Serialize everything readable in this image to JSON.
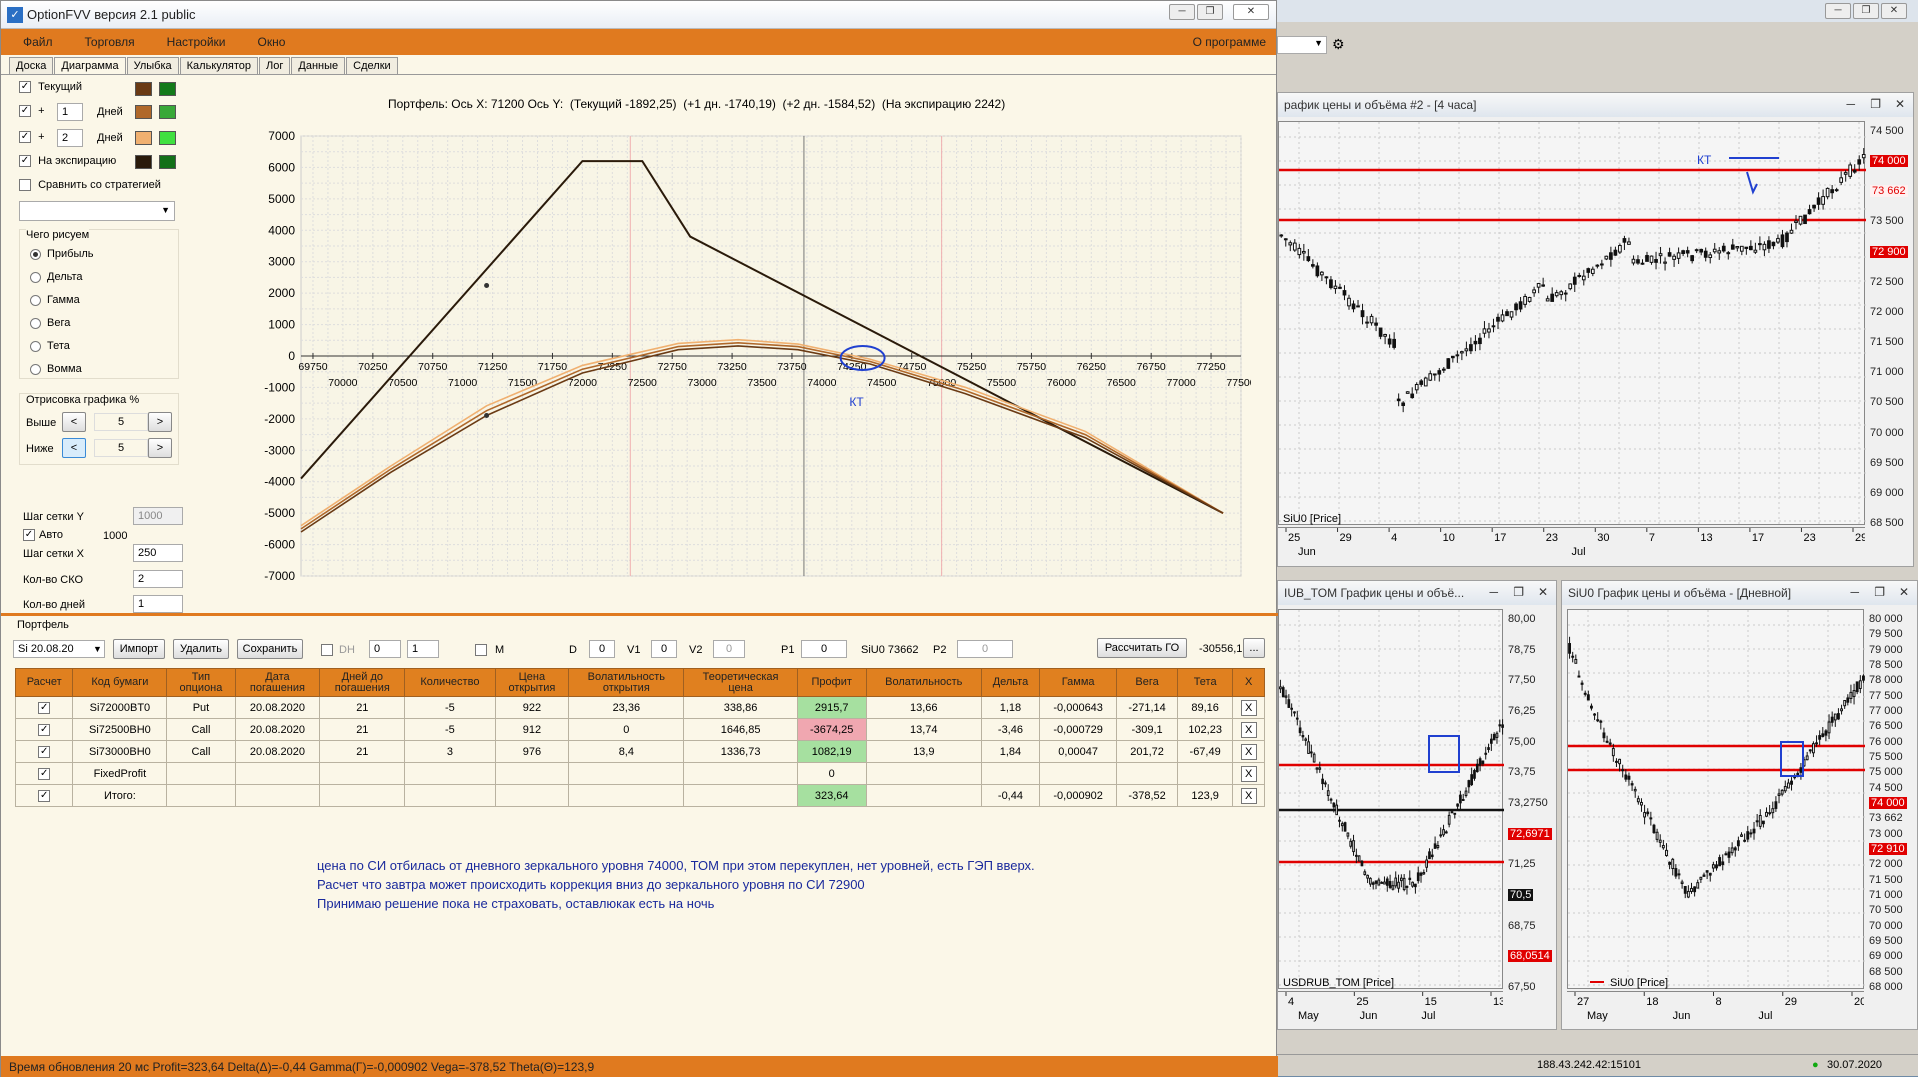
{
  "app": {
    "title": "OptionFVV версия 2.1 public",
    "menu": [
      "Файл",
      "Торговля",
      "Настройки",
      "Окно"
    ],
    "about": "О программе"
  },
  "tabs": [
    "Доска",
    "Диаграмма",
    "Улыбка",
    "Калькулятор",
    "Лог",
    "Данные",
    "Сделки"
  ],
  "left": {
    "curves": [
      {
        "label": "Текущий",
        "checked": "✓",
        "c1": "#6a3a14",
        "c2": "#137a1a"
      },
      {
        "label": "Дней",
        "checked": "✓",
        "prefix": "+",
        "days": "1",
        "c1": "#b0682a",
        "c2": "#38a838"
      },
      {
        "label": "Дней",
        "checked": "✓",
        "prefix": "+",
        "days": "2",
        "c1": "#f0b070",
        "c2": "#40e040"
      },
      {
        "label": "На экспирацию",
        "checked": "✓",
        "c1": "#2a1a0a",
        "c2": "#127018"
      }
    ],
    "compare": "Сравнить со стратегией",
    "what_title": "Чего рисуем",
    "what": [
      "Прибыль",
      "Дельта",
      "Гамма",
      "Вега",
      "Тета",
      "Вомма"
    ],
    "draw_title": "Отрисовка графика %",
    "above": "Выше",
    "above_val": "5",
    "below": "Ниже",
    "below_val": "5",
    "lt": "<",
    "gt": ">",
    "gridY": "Шаг сетки Y",
    "gridY_val": "1000",
    "auto": "Авто",
    "auto_val": "1000",
    "gridX": "Шаг сетки X",
    "gridX_val": "250",
    "sko": "Кол-во СКО",
    "sko_val": "2",
    "days": "Кол-во дней",
    "days_val": "1"
  },
  "chart_header": "Портфель: Ось X: 71200 Ось Y:  (Текущий -1892,25)  (+1 дн. -1740,19)  (+2 дн. -1584,52)  (На экспирацию 2242)",
  "chart_data": {
    "type": "line",
    "yticks": [
      "7000",
      "6000",
      "5000",
      "4000",
      "3000",
      "2000",
      "1000",
      "0",
      "-1000",
      "-2000",
      "-3000",
      "-4000",
      "-5000",
      "-6000",
      "-7000"
    ],
    "xticks_top": [
      "69750",
      "70250",
      "70750",
      "71250",
      "71750",
      "72250",
      "72750",
      "73250",
      "73750",
      "74250",
      "74750",
      "75250",
      "75750",
      "76250",
      "76750",
      "77250"
    ],
    "xticks_bottom": [
      "70000",
      "70500",
      "71000",
      "71500",
      "72000",
      "72500",
      "73000",
      "73500",
      "74000",
      "74500",
      "75000",
      "75500",
      "76000",
      "76500",
      "77000",
      "77500"
    ],
    "xlim": [
      69650,
      77500
    ],
    "ylim": [
      -7000,
      7000
    ],
    "series": [
      {
        "name": "На экспирацию",
        "color": "#2a1a0a",
        "x": [
          69650,
          72000,
          72500,
          72900,
          77350
        ],
        "y": [
          -3900,
          6200,
          6200,
          3800,
          -5000
        ]
      },
      {
        "name": "+2 дн.",
        "color": "#f0b070",
        "x": [
          69650,
          70400,
          71200,
          72000,
          72800,
          73300,
          73800,
          74400,
          75200,
          76200,
          77350
        ],
        "y": [
          -5400,
          -3500,
          -1584,
          -300,
          400,
          520,
          380,
          -100,
          -1000,
          -2400,
          -5000
        ]
      },
      {
        "name": "+1 дн.",
        "color": "#b0682a",
        "x": [
          69650,
          70400,
          71200,
          72000,
          72800,
          73300,
          73800,
          74400,
          75200,
          76200,
          77350
        ],
        "y": [
          -5500,
          -3600,
          -1740,
          -420,
          300,
          420,
          300,
          -170,
          -1100,
          -2500,
          -5000
        ]
      },
      {
        "name": "Текущий",
        "color": "#6a3a14",
        "x": [
          69650,
          70400,
          71200,
          72000,
          72800,
          73300,
          73800,
          74400,
          75200,
          76200,
          77350
        ],
        "y": [
          -5600,
          -3700,
          -1892,
          -540,
          200,
          320,
          200,
          -250,
          -1200,
          -2600,
          -5000
        ]
      }
    ],
    "kt": "КТ"
  },
  "portfolio": {
    "label": "Портфель",
    "selector": "Si 20.08.20",
    "import": "Импорт",
    "delete": "Удалить",
    "save": "Сохранить",
    "dh": "DH",
    "dh1": "0",
    "dh2": "1",
    "m": "M",
    "d": "D",
    "d_val": "0",
    "v1": "V1",
    "v1_val": "0",
    "v2": "V2",
    "v2_val": "0",
    "p1": "P1",
    "p1_val": "0",
    "siu": "SiU0 73662",
    "p2": "P2",
    "p2_val": "0",
    "calc": "Рассчитать ГО",
    "go": "-30556,1",
    "dots": "..."
  },
  "table": {
    "headers": [
      "Расчет",
      "Код бумаги",
      "Тип\nопциона",
      "Дата\nпогашения",
      "Дней до\nпогашения",
      "Количество",
      "Цена\nоткрытия",
      "Волатильность\nоткрытия",
      "Теоретическая\nцена",
      "Профит",
      "Волатильность",
      "Дельта",
      "Гамма",
      "Вега",
      "Тета",
      "X"
    ],
    "rows": [
      [
        "✓",
        "Si72000BT0",
        "Put",
        "20.08.2020",
        "21",
        "-5",
        "922",
        "23,36",
        "338,86",
        "2915,7",
        "13,66",
        "1,18",
        "-0,000643",
        "-271,14",
        "89,16",
        "X"
      ],
      [
        "✓",
        "Si72500BH0",
        "Call",
        "20.08.2020",
        "21",
        "-5",
        "912",
        "0",
        "1646,85",
        "-3674,25",
        "13,74",
        "-3,46",
        "-0,000729",
        "-309,1",
        "102,23",
        "X"
      ],
      [
        "✓",
        "Si73000BH0",
        "Call",
        "20.08.2020",
        "21",
        "3",
        "976",
        "8,4",
        "1336,73",
        "1082,19",
        "13,9",
        "1,84",
        "0,00047",
        "201,72",
        "-67,49",
        "X"
      ],
      [
        "✓",
        "FixedProfit",
        "",
        "",
        "",
        "",
        "",
        "",
        "",
        "0",
        "",
        "",
        "",
        "",
        "",
        "X"
      ],
      [
        "✓",
        "Итого:",
        "",
        "",
        "",
        "",
        "",
        "",
        "",
        "323,64",
        "",
        "-0,44",
        "-0,000902",
        "-378,52",
        "123,9",
        "X"
      ]
    ]
  },
  "notes": [
    "цена по СИ отбилась от дневного зеркального уровня 74000, ТОМ при этом перекуплен, нет уровней, есть ГЭП вверх.",
    "Расчет что завтра может происходить коррекция вниз до зеркального уровня по СИ 72900",
    "Принимаю решение пока не страховать, оставлюкак есть на ночь"
  ],
  "status": "Время обновления 20 мс  Profit=323,64 Delta(Δ)=-0,44 Gamma(Γ)=-0,000902 Vega=-378,52 Theta(Θ)=123,9",
  "right": {
    "win1": {
      "title": "рафик цены и объёма #2 - [4 часа]",
      "prices": [
        "74 500",
        "74 000",
        "73 662",
        "73 500",
        "72 900",
        "72 500",
        "72 000",
        "71 500",
        "71 000",
        "70 500",
        "70 000",
        "69 500",
        "69 000",
        "68 500"
      ],
      "dates": [
        "25",
        "29",
        "4",
        "10",
        "17",
        "23",
        "30",
        "7",
        "13",
        "17",
        "23",
        "29"
      ],
      "months": [
        "Jun",
        "Jul"
      ],
      "legend": "SiU0 [Price]",
      "kt": "КТ"
    },
    "win2": {
      "title": "IUB_TOM График цены и объё...",
      "prices": [
        "80,00",
        "78,75",
        "77,50",
        "76,25",
        "75,00",
        "73,75",
        "73,2750",
        "72,6971",
        "71,25",
        "70,5",
        "68,75",
        "68,0514",
        "67,50"
      ],
      "dates": [
        "4",
        "25",
        "15",
        "13"
      ],
      "months": [
        "May",
        "Jun",
        "Jul"
      ],
      "legend": "USDRUB_TOM [Price]"
    },
    "win3": {
      "title": "SiU0 График цены и объёма - [Дневной]",
      "prices": [
        "80 000",
        "79 500",
        "79 000",
        "78 500",
        "78 000",
        "77 500",
        "77 000",
        "76 500",
        "76 000",
        "75 500",
        "75 000",
        "74 500",
        "74 000",
        "73 662",
        "73 000",
        "72 910",
        "72 000",
        "71 500",
        "71 000",
        "70 500",
        "70 000",
        "69 500",
        "69 000",
        "68 500",
        "68 000"
      ],
      "dates": [
        "27",
        "18",
        "8",
        "29",
        "20"
      ],
      "months": [
        "May",
        "Jun",
        "Jul"
      ],
      "legend": "SiU0 [Price]"
    },
    "ip": "188.43.242.42:15101",
    "date": "30.07.2020"
  }
}
